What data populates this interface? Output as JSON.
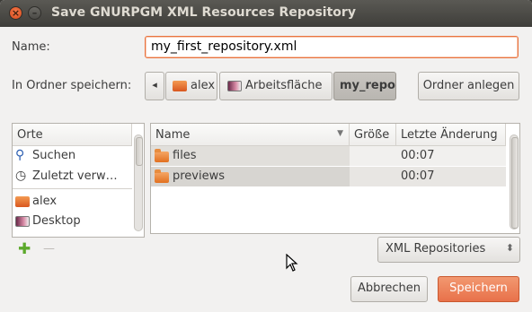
{
  "window": {
    "title": "Save GNURPGM XML Resources Repository",
    "close_glyph": "×",
    "minimize_glyph": "–"
  },
  "name_label": "Name:",
  "name_value": "my_first_repository.xml",
  "folder_label": "In Ordner speichern:",
  "path_back": "◂",
  "path": [
    {
      "label": "alex",
      "icon": "home-folder-icon"
    },
    {
      "label": "Arbeitsfläche",
      "icon": "desktop-icon"
    },
    {
      "label": "my_repo",
      "icon": "none",
      "active": true
    }
  ],
  "create_folder_label": "Ordner anlegen",
  "places": {
    "header": "Orte",
    "items": [
      {
        "label": "Suchen",
        "icon": "search-icon"
      },
      {
        "label": "Zuletzt verw…",
        "icon": "recent-icon"
      },
      {
        "label": "alex",
        "icon": "home-folder-icon"
      },
      {
        "label": "Desktop",
        "icon": "desktop-icon"
      }
    ],
    "add_glyph": "✚",
    "remove_glyph": "—"
  },
  "files": {
    "columns": [
      "Name",
      "Größe",
      "Letzte Änderung"
    ],
    "sort_glyph": "▼",
    "rows": [
      {
        "name": "files",
        "size": "",
        "modified": "00:07"
      },
      {
        "name": "previews",
        "size": "",
        "modified": "00:07"
      }
    ]
  },
  "filter": {
    "selected": "XML Repositories",
    "spinner_glyph": "⬍"
  },
  "buttons": {
    "cancel": "Abbrechen",
    "save": "Speichern"
  },
  "colors": {
    "accent": "#e9733f",
    "titlebar": "#3c3b37",
    "window_bg": "#f2f1f0"
  }
}
